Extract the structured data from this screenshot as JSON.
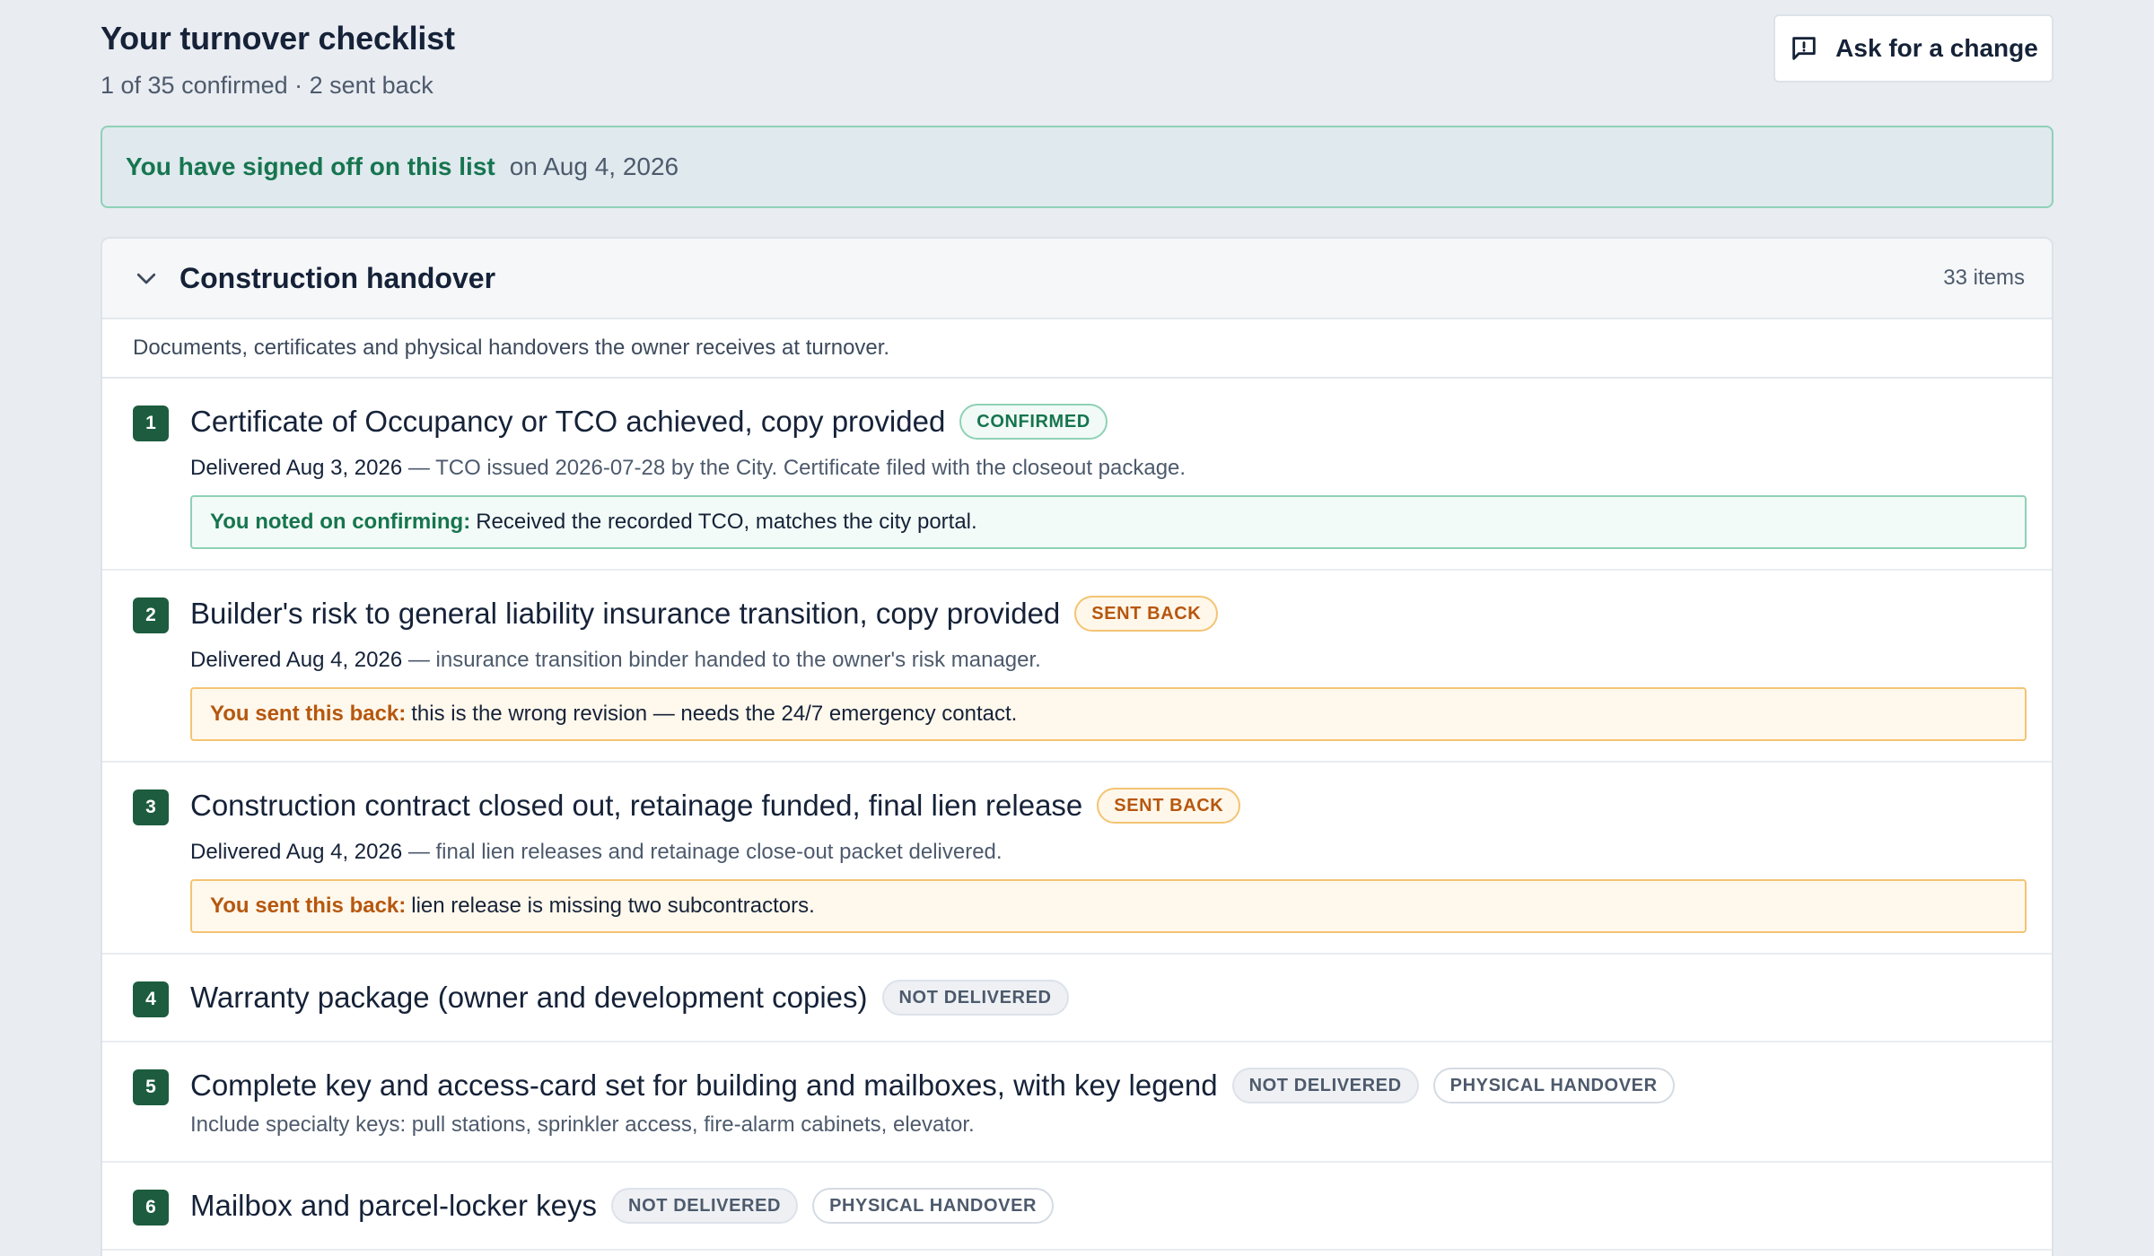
{
  "header": {
    "title": "Your turnover checklist",
    "subtitle": "1 of 35 confirmed · 2 sent back",
    "ask_button": "Ask for a change",
    "ask_icon": "message-alert-icon"
  },
  "banner": {
    "strong": "You have signed off on this list",
    "date": "on Aug 4, 2026"
  },
  "section": {
    "title": "Construction handover",
    "count": "33 items",
    "description": "Documents, certificates and physical handovers the owner receives at turnover.",
    "items": [
      {
        "number": "1",
        "title": "Certificate of Occupancy or TCO achieved, copy provided",
        "badges": [
          "CONFIRMED"
        ],
        "delivered": "Delivered Aug 3, 2026",
        "detail": " — TCO issued 2026-07-28 by the City. Certificate filed with the closeout package.",
        "note_label": "You noted on confirming:",
        "note_text": "Received the recorded TCO, matches the city portal."
      },
      {
        "number": "2",
        "title": "Builder's risk to general liability insurance transition, copy provided",
        "badges": [
          "SENT BACK"
        ],
        "delivered": "Delivered Aug 4, 2026",
        "detail": " — insurance transition binder handed to the owner's risk manager.",
        "note_label": "You sent this back:",
        "note_text": "this is the wrong revision — needs the 24/7 emergency contact."
      },
      {
        "number": "3",
        "title": "Construction contract closed out, retainage funded, final lien release",
        "badges": [
          "SENT BACK"
        ],
        "delivered": "Delivered Aug 4, 2026",
        "detail": " — final lien releases and retainage close-out packet delivered.",
        "note_label": "You sent this back:",
        "note_text": "lien release is missing two subcontractors."
      },
      {
        "number": "4",
        "title": "Warranty package (owner and development copies)",
        "badges": [
          "NOT DELIVERED"
        ]
      },
      {
        "number": "5",
        "title": "Complete key and access-card set for building and mailboxes, with key legend",
        "badges": [
          "NOT DELIVERED",
          "PHYSICAL HANDOVER"
        ],
        "detail": "Include specialty keys: pull stations, sprinkler access, fire-alarm cabinets, elevator."
      },
      {
        "number": "6",
        "title": "Mailbox and parcel-locker keys",
        "badges": [
          "NOT DELIVERED",
          "PHYSICAL HANDOVER"
        ]
      }
    ]
  },
  "colors": {
    "accent_green": "#16754f",
    "number_badge": "#1d5c3f",
    "amber": "#b6570e",
    "background": "#e9ecf1"
  }
}
